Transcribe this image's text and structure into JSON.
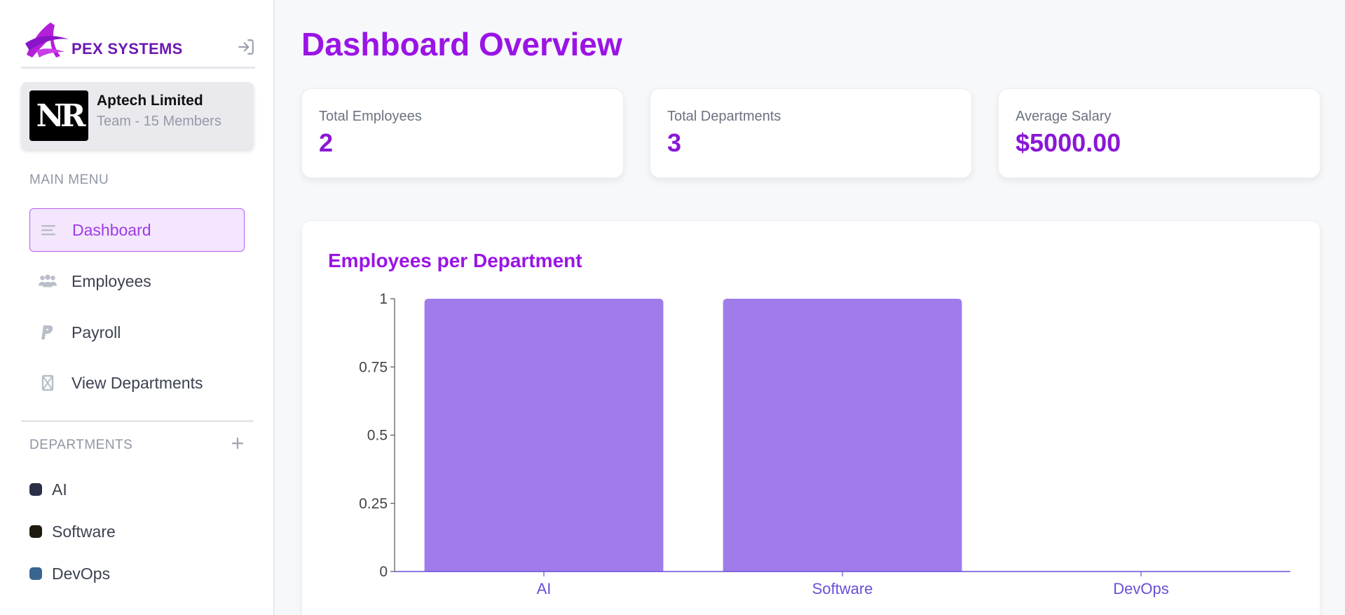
{
  "brand": {
    "name": "PEX SYSTEMS",
    "logo_icon": "apex-logo"
  },
  "team": {
    "avatar_text": "NR",
    "name": "Aptech Limited",
    "subtitle": "Team - 15 Members"
  },
  "sidebar": {
    "main_menu_label": "MAIN MENU",
    "items": [
      {
        "label": "Dashboard",
        "icon": "lines-icon",
        "active": true
      },
      {
        "label": "Employees",
        "icon": "users-icon",
        "active": false
      },
      {
        "label": "Payroll",
        "icon": "paypal-icon",
        "active": false
      },
      {
        "label": "View Departments",
        "icon": "building-icon",
        "active": false
      }
    ],
    "departments_label": "DEPARTMENTS",
    "add_icon": "plus-icon",
    "departments": [
      {
        "label": "AI",
        "color": "#2a2f47"
      },
      {
        "label": "Software",
        "color": "#1e1a10"
      },
      {
        "label": "DevOps",
        "color": "#3a6591"
      }
    ]
  },
  "main": {
    "title": "Dashboard Overview",
    "stats": [
      {
        "label": "Total Employees",
        "value": "2"
      },
      {
        "label": "Total Departments",
        "value": "3"
      },
      {
        "label": "Average Salary",
        "value": "$5000.00"
      }
    ]
  },
  "colors": {
    "accent": "#9a14e6",
    "bar": "#a07ceb",
    "axis": "#6b4fd6"
  },
  "chart_data": {
    "type": "bar",
    "title": "Employees per Department",
    "categories": [
      "AI",
      "Software",
      "DevOps"
    ],
    "values": [
      1,
      1,
      0
    ],
    "ylim": [
      0,
      1
    ],
    "yticks": [
      "0",
      "0.25",
      "0.5",
      "0.75",
      "1"
    ],
    "xlabel": "",
    "ylabel": ""
  }
}
